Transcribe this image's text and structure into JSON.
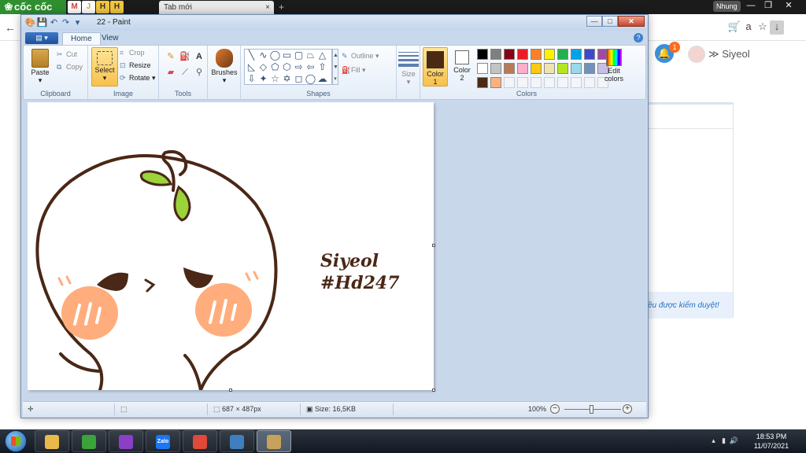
{
  "browser": {
    "brand": "cốc cốc",
    "tabs": [
      {
        "icon": "gmail-icon",
        "label": "M",
        "color": "#d44638"
      },
      {
        "icon": "tab-j-icon",
        "label": "J",
        "color": "#e8a13a"
      },
      {
        "icon": "tab-h1-icon",
        "label": "H",
        "color": "#f2c53d"
      },
      {
        "icon": "tab-h2-icon",
        "label": "H",
        "color": "#f2c53d"
      }
    ],
    "active_tab": {
      "title": "Tab mới",
      "close": "×"
    },
    "new_tab": "+",
    "user_chip": "Nhung",
    "window_controls": {
      "minimize": "—",
      "maximize": "❐",
      "close": "✕"
    },
    "back": "←",
    "toolbar_icons": {
      "cart": "🛒",
      "translate": "a",
      "star": "☆",
      "download": "↓"
    }
  },
  "website": {
    "notification_count": "1",
    "username": "Siyeol",
    "user_prefix": "≫",
    "note": "ều được kiểm duyệt!"
  },
  "paint": {
    "title": "22 - Paint",
    "window_controls": {
      "minimize": "—",
      "maximize": "□",
      "close": "✕"
    },
    "menu_label": "▤ ▾",
    "tabs": {
      "home": "Home",
      "view": "View"
    },
    "help": "?",
    "groups": {
      "clipboard": "Clipboard",
      "image": "Image",
      "tools": "Tools",
      "shapes": "Shapes",
      "colors": "Colors"
    },
    "clipboard": {
      "paste": "Paste",
      "cut": "Cut",
      "copy": "Copy"
    },
    "image": {
      "select": "Select",
      "crop": "Crop",
      "resize": "Resize",
      "rotate": "Rotate"
    },
    "brushes": "Brushes",
    "shape_options": {
      "outline": "Outline",
      "fill": "Fill"
    },
    "size": "Size",
    "color1": {
      "label": "Color",
      "index": "1",
      "value": "#4a2a12"
    },
    "color2": {
      "label": "Color",
      "index": "2",
      "value": "#ffffff"
    },
    "edit_colors": {
      "line1": "Edit",
      "line2": "colors"
    },
    "palette": [
      "#000000",
      "#7f7f7f",
      "#880015",
      "#ed1c24",
      "#ff7f27",
      "#fff200",
      "#22b14c",
      "#00a2e8",
      "#3f48cc",
      "#a349a4",
      "#ffffff",
      "#c3c3c3",
      "#b97a57",
      "#ffaec9",
      "#ffc90e",
      "#efe4b0",
      "#b5e61d",
      "#99d9ea",
      "#7092be",
      "#c8bfe7",
      "#4a2a12",
      "#ffb07c"
    ],
    "canvas_text": {
      "line1": "Siyeol",
      "line2": "#Hd247"
    },
    "status": {
      "dimensions": "687 × 487px",
      "size": "Size: 16,5KB",
      "zoom": "100%",
      "zoom_out": "−",
      "zoom_in": "+"
    }
  },
  "taskbar": {
    "apps": [
      {
        "name": "file-explorer",
        "icon": "folder-icon",
        "color": "#e9b949",
        "label": ""
      },
      {
        "name": "coccoc-browser",
        "icon": "coccoc-icon",
        "color": "#3aa33a",
        "label": ""
      },
      {
        "name": "game-app",
        "icon": "game-icon",
        "color": "#8a3fc4",
        "label": ""
      },
      {
        "name": "zalo",
        "icon": "zalo-icon",
        "color": "#1a76f2",
        "label": "Zalo"
      },
      {
        "name": "chrome",
        "icon": "chrome-icon",
        "color": "#e0483a",
        "label": ""
      },
      {
        "name": "photo-viewer",
        "icon": "photo-icon",
        "color": "#3f7fbf",
        "label": ""
      },
      {
        "name": "paint",
        "icon": "paint-icon",
        "color": "#c9a25a",
        "label": ""
      }
    ],
    "clock": {
      "time": "18:53 PM",
      "date": "11/07/2021"
    },
    "tray": {
      "arrow": "▴",
      "signal": "▮",
      "volume": "🔊"
    }
  }
}
